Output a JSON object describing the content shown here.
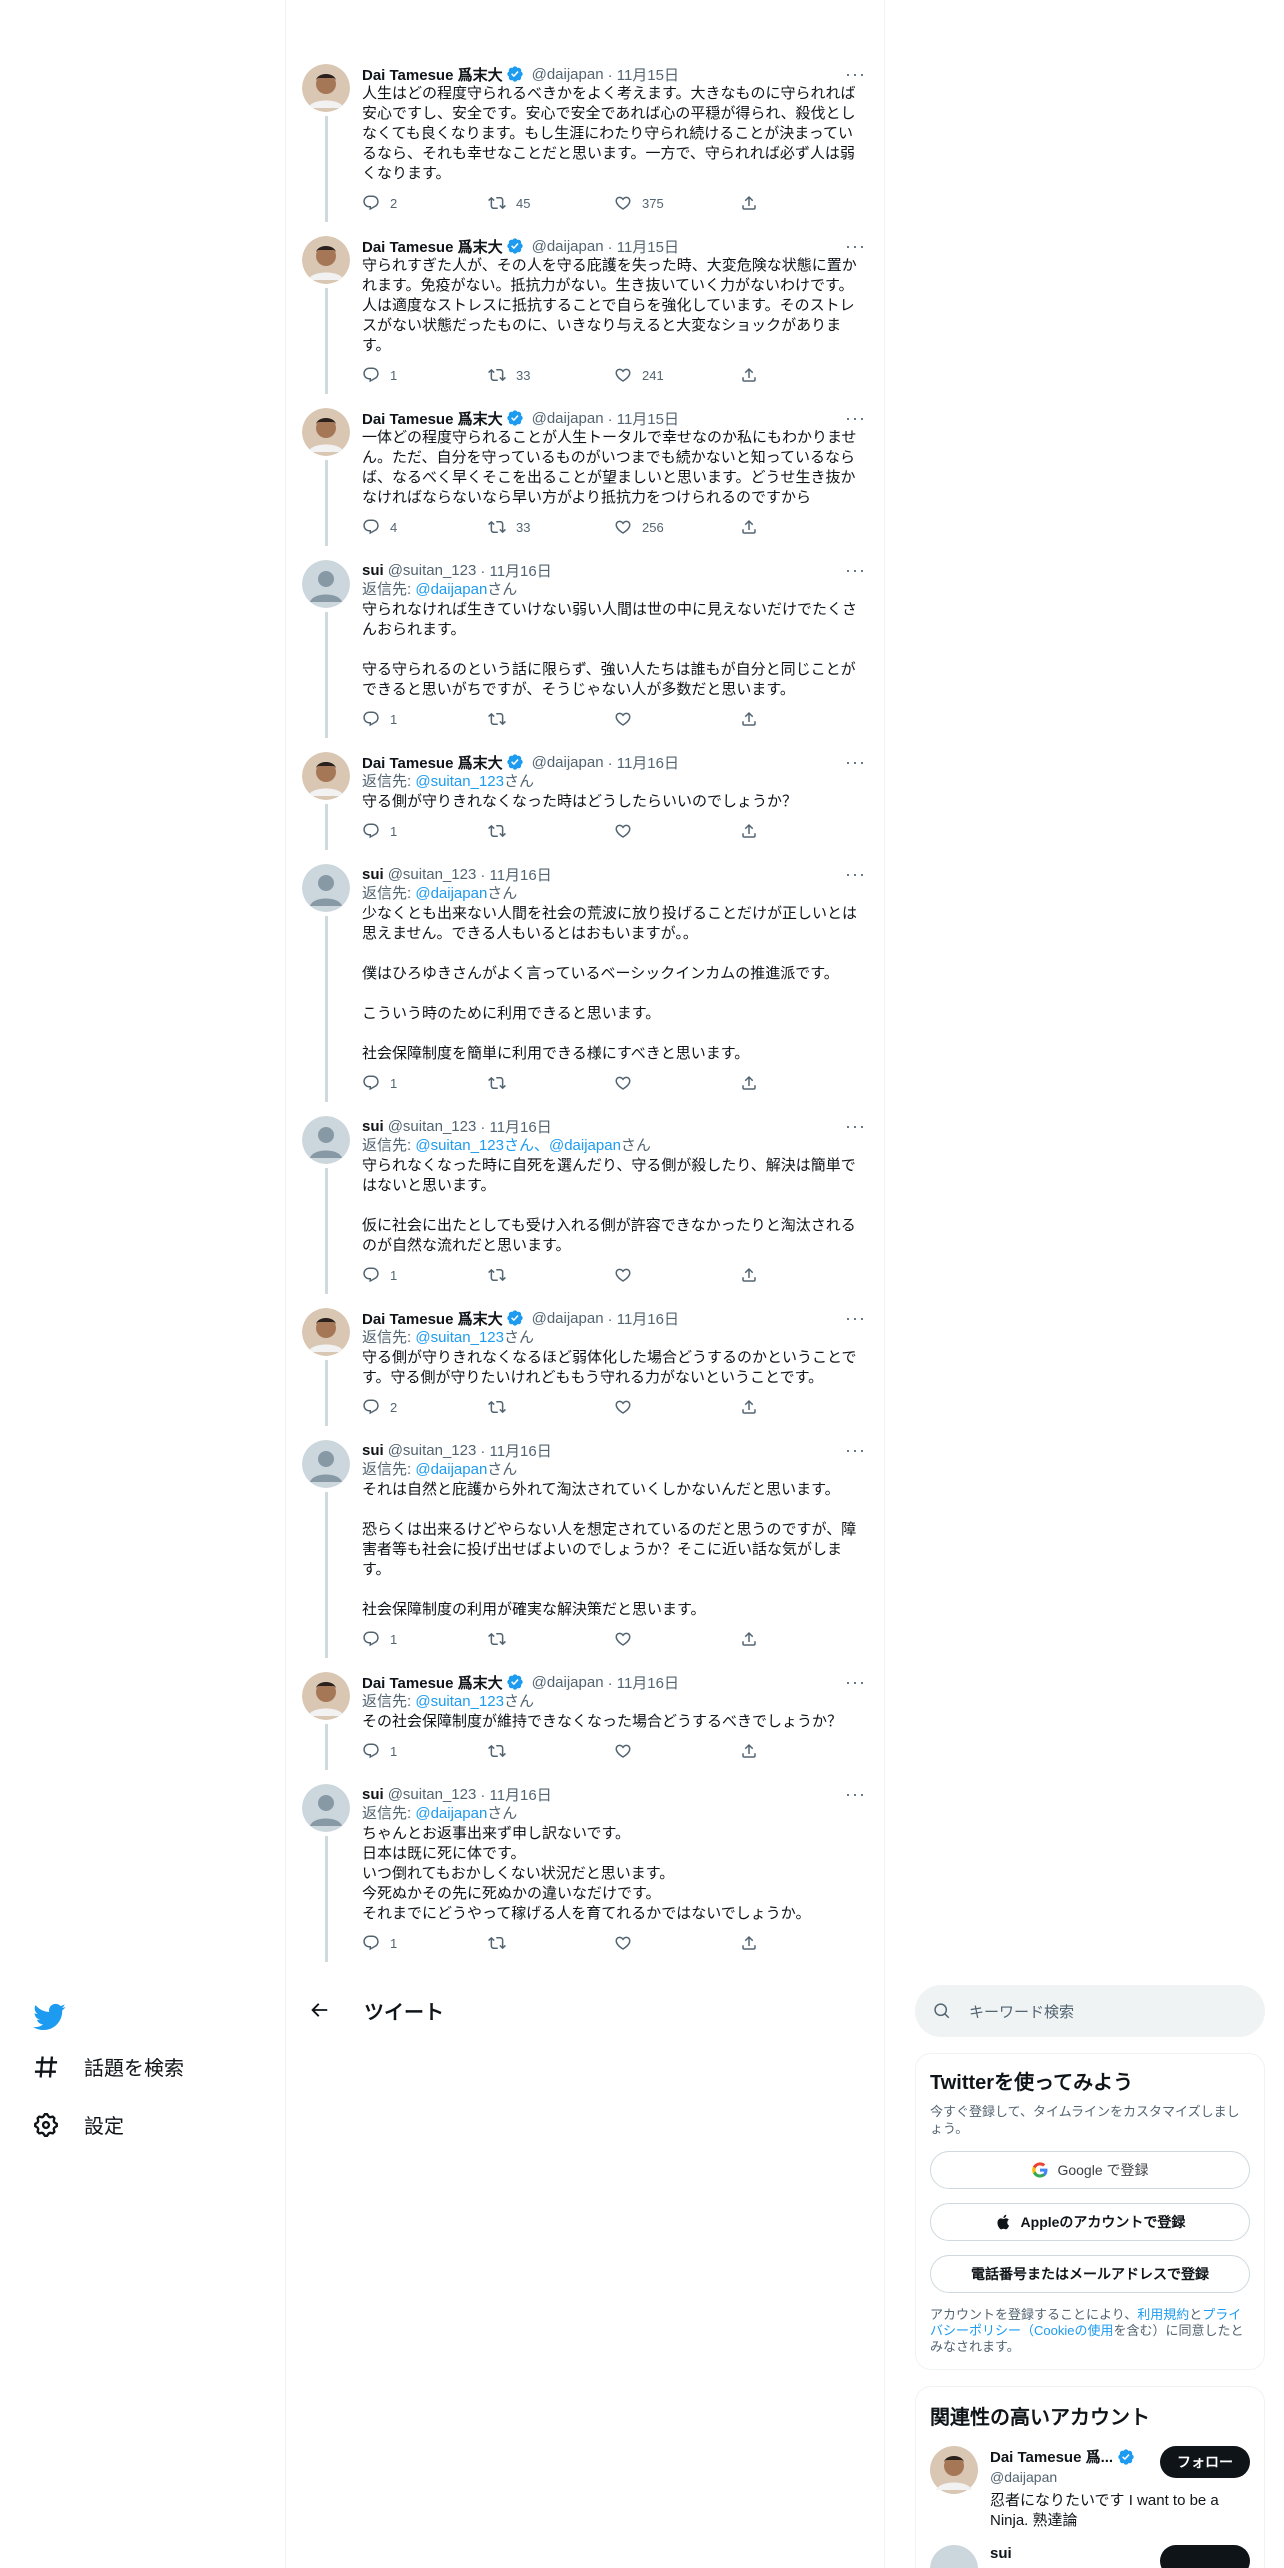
{
  "nav": {
    "explore": "話題を検索",
    "settings": "設定"
  },
  "header": {
    "title": "ツイート"
  },
  "right": {
    "search_placeholder": "キーワード検索",
    "signup": {
      "title": "Twitterを使ってみよう",
      "subtitle": "今すぐ登録して、タイムラインをカスタマイズしましょう。",
      "google": "Google で登録",
      "apple": "Appleのアカウントで登録",
      "phone": "電話番号またはメールアドレスで登録",
      "legal_pre": "アカウントを登録することにより、",
      "legal_terms": "利用規約",
      "legal_and": "と",
      "legal_privacy": "プライバシーポリシー",
      "legal_cookie": "（Cookieの使用",
      "legal_post": "を含む）に同意したとみなされます。"
    },
    "related": {
      "title": "関連性の高いアカウント",
      "accounts": [
        {
          "name": "Dai Tamesue 爲...",
          "handle": "@daijapan",
          "bio": "忍者になりたいです I want to be a Ninja. 熟達論",
          "follow": "フォロー"
        },
        {
          "name": "sui",
          "handle": "",
          "bio": "",
          "follow": ""
        }
      ]
    }
  },
  "tweets": [
    {
      "name": "Dai Tamesue 爲末大",
      "handle": "@daijapan",
      "date": "· 11月15日",
      "verified": true,
      "reply_prefix": "",
      "reply_to": "",
      "reply_suffix": "",
      "text": "人生はどの程度守られるべきかをよく考えます。大きなものに守られれば安心ですし、安全です。安心で安全であれば心の平穏が得られ、殺伐としなくても良くなります。もし生涯にわたり守られ続けることが決まっているなら、それも幸せなことだと思います。一方で、守られれば必ず人は弱くなります。",
      "replies": "2",
      "retweets": "45",
      "likes": "375"
    },
    {
      "name": "Dai Tamesue 爲末大",
      "handle": "@daijapan",
      "date": "· 11月15日",
      "verified": true,
      "reply_prefix": "",
      "reply_to": "",
      "reply_suffix": "",
      "text": "守られすぎた人が、その人を守る庇護を失った時、大変危険な状態に置かれます。免疫がない。抵抗力がない。生き抜いていく力がないわけです。人は適度なストレスに抵抗することで自らを強化しています。そのストレスがない状態だったものに、いきなり与えると大変なショックがあります。",
      "replies": "1",
      "retweets": "33",
      "likes": "241"
    },
    {
      "name": "Dai Tamesue 爲末大",
      "handle": "@daijapan",
      "date": "· 11月15日",
      "verified": true,
      "reply_prefix": "",
      "reply_to": "",
      "reply_suffix": "",
      "text": "一体どの程度守られることが人生トータルで幸せなのか私にもわかりません。ただ、自分を守っているものがいつまでも続かないと知っているならば、なるべく早くそこを出ることが望ましいと思います。どうせ生き抜かなければならないなら早い方がより抵抗力をつけられるのですから",
      "replies": "4",
      "retweets": "33",
      "likes": "256"
    },
    {
      "name": "sui",
      "handle": "@suitan_123",
      "date": "· 11月16日",
      "verified": false,
      "reply_prefix": "返信先: ",
      "reply_to": "@daijapan",
      "reply_suffix": "さん",
      "text": "守られなければ生きていけない弱い人間は世の中に見えないだけでたくさんおられます。\n\n守る守られるのという話に限らず、強い人たちは誰もが自分と同じことができると思いがちですが、そうじゃない人が多数だと思います。",
      "replies": "1",
      "retweets": "",
      "likes": ""
    },
    {
      "name": "Dai Tamesue 爲末大",
      "handle": "@daijapan",
      "date": "· 11月16日",
      "verified": true,
      "reply_prefix": "返信先: ",
      "reply_to": "@suitan_123",
      "reply_suffix": "さん",
      "text": "守る側が守りきれなくなった時はどうしたらいいのでしょうか？",
      "replies": "1",
      "retweets": "",
      "likes": ""
    },
    {
      "name": "sui",
      "handle": "@suitan_123",
      "date": "· 11月16日",
      "verified": false,
      "reply_prefix": "返信先: ",
      "reply_to": "@daijapan",
      "reply_suffix": "さん",
      "text": "少なくとも出来ない人間を社会の荒波に放り投げることだけが正しいとは思えません。できる人もいるとはおもいますが。。\n\n僕はひろゆきさんがよく言っているベーシックインカムの推進派です。\n\nこういう時のために利用できると思います。\n\n社会保障制度を簡単に利用できる様にすべきと思います。",
      "replies": "1",
      "retweets": "",
      "likes": ""
    },
    {
      "name": "sui",
      "handle": "@suitan_123",
      "date": "· 11月16日",
      "verified": false,
      "reply_prefix": "返信先: ",
      "reply_to": "@suitan_123さん、@daijapan",
      "reply_suffix": "さん",
      "text": "守られなくなった時に自死を選んだり、守る側が殺したり、解決は簡単ではないと思います。\n\n仮に社会に出たとしても受け入れる側が許容できなかったりと淘汰されるのが自然な流れだと思います。",
      "replies": "1",
      "retweets": "",
      "likes": ""
    },
    {
      "name": "Dai Tamesue 爲末大",
      "handle": "@daijapan",
      "date": "· 11月16日",
      "verified": true,
      "reply_prefix": "返信先: ",
      "reply_to": "@suitan_123",
      "reply_suffix": "さん",
      "text": "守る側が守りきれなくなるほど弱体化した場合どうするのかということです。守る側が守りたいけれどももう守れる力がないということです。",
      "replies": "2",
      "retweets": "",
      "likes": ""
    },
    {
      "name": "sui",
      "handle": "@suitan_123",
      "date": "· 11月16日",
      "verified": false,
      "reply_prefix": "返信先: ",
      "reply_to": "@daijapan",
      "reply_suffix": "さん",
      "text": "それは自然と庇護から外れて淘汰されていくしかないんだと思います。\n\n恐らくは出来るけどやらない人を想定されているのだと思うのですが、障害者等も社会に投げ出せばよいのでしょうか？そこに近い話な気がします。\n\n社会保障制度の利用が確実な解決策だと思います。",
      "replies": "1",
      "retweets": "",
      "likes": ""
    },
    {
      "name": "Dai Tamesue 爲末大",
      "handle": "@daijapan",
      "date": "· 11月16日",
      "verified": true,
      "reply_prefix": "返信先: ",
      "reply_to": "@suitan_123",
      "reply_suffix": "さん",
      "text": "その社会保障制度が維持できなくなった場合どうするべきでしょうか？",
      "replies": "1",
      "retweets": "",
      "likes": ""
    },
    {
      "name": "sui",
      "handle": "@suitan_123",
      "date": "· 11月16日",
      "verified": false,
      "reply_prefix": "返信先: ",
      "reply_to": "@daijapan",
      "reply_suffix": "さん",
      "text": "ちゃんとお返事出来ず申し訳ないです。\n日本は既に死に体です。\nいつ倒れてもおかしくない状況だと思います。\n今死ぬかその先に死ぬかの違いなだけです。\nそれまでにどうやって稼げる人を育てれるかではないでしょうか。",
      "replies": "1",
      "retweets": "",
      "likes": ""
    }
  ]
}
